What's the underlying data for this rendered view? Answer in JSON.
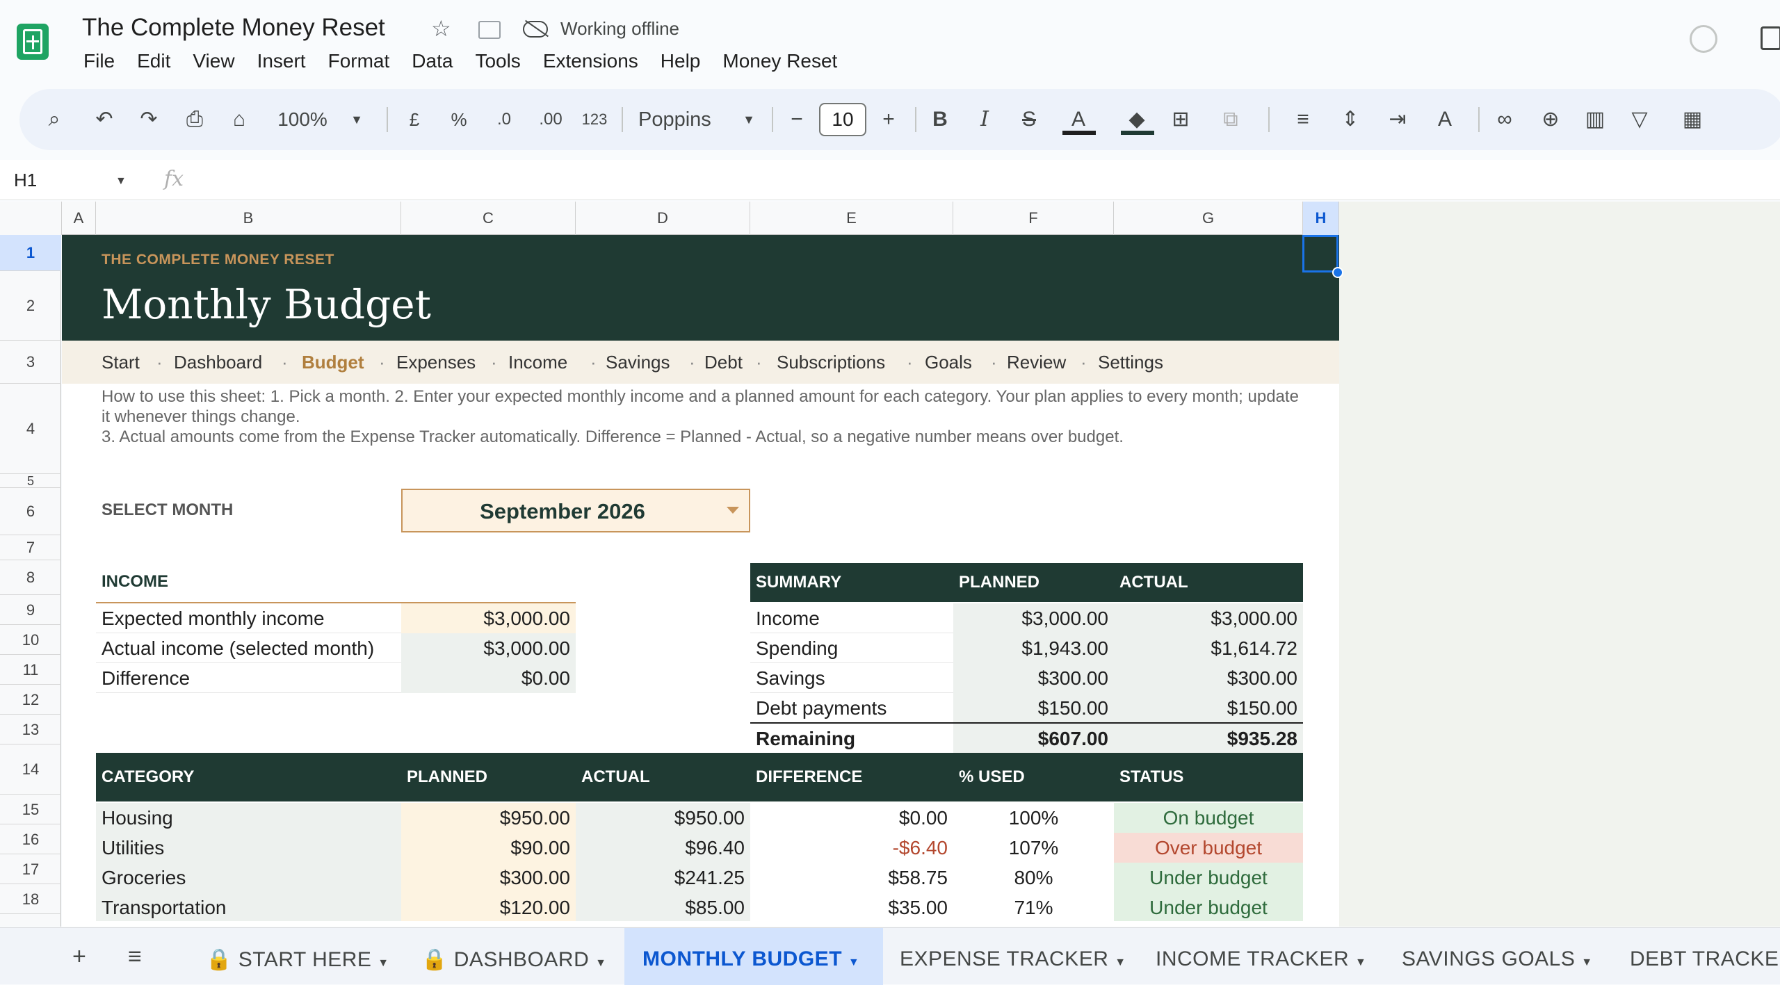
{
  "app": {
    "doc_title": "The Complete Money Reset",
    "status": "Working offline",
    "menu": [
      "File",
      "Edit",
      "View",
      "Insert",
      "Format",
      "Data",
      "Tools",
      "Extensions",
      "Help",
      "Money Reset"
    ]
  },
  "toolbar": {
    "zoom": "100%",
    "currency": "£",
    "percent": "%",
    "dec_decrease": ".0",
    "dec_increase": ".00",
    "format_123": "123",
    "font": "Poppins",
    "font_size": "10",
    "minus": "−",
    "plus": "+",
    "bold": "B",
    "italic": "I",
    "text_color": "A"
  },
  "formula_bar": {
    "name_box": "H1",
    "fx": "fx"
  },
  "columns": [
    "A",
    "B",
    "C",
    "D",
    "E",
    "F",
    "G",
    "H"
  ],
  "rows": [
    "1",
    "2",
    "3",
    "4",
    "5",
    "6",
    "7",
    "8",
    "9",
    "10",
    "11",
    "12",
    "13",
    "14",
    "15",
    "16",
    "17",
    "18"
  ],
  "sheet": {
    "kicker": "THE COMPLETE MONEY RESET",
    "title": "Monthly Budget",
    "nav": [
      "Start",
      "Dashboard",
      "Budget",
      "Expenses",
      "Income",
      "Savings",
      "Debt",
      "Subscriptions",
      "Goals",
      "Review",
      "Settings"
    ],
    "nav_sep": "·",
    "help": "How to use this sheet:  1. Pick a month.  2. Enter your expected monthly income and a planned amount for each category. Your plan applies to every month; update it whenever things change.\n3. Actual amounts come from the Expense Tracker automatically. Difference = Planned - Actual, so a negative number means over budget.",
    "select_month_label": "SELECT MONTH",
    "selected_month": "September 2026",
    "income": {
      "header": "INCOME",
      "rows": [
        {
          "label": "Expected monthly income",
          "value": "$3,000.00"
        },
        {
          "label": "Actual income (selected month)",
          "value": "$3,000.00"
        },
        {
          "label": "Difference",
          "value": "$0.00"
        }
      ]
    },
    "summary": {
      "headers": [
        "SUMMARY",
        "PLANNED",
        "ACTUAL"
      ],
      "rows": [
        {
          "label": "Income",
          "planned": "$3,000.00",
          "actual": "$3,000.00"
        },
        {
          "label": "Spending",
          "planned": "$1,943.00",
          "actual": "$1,614.72"
        },
        {
          "label": "Savings",
          "planned": "$300.00",
          "actual": "$300.00"
        },
        {
          "label": "Debt payments",
          "planned": "$150.00",
          "actual": "$150.00"
        },
        {
          "label": "Remaining",
          "planned": "$607.00",
          "actual": "$935.28"
        }
      ]
    },
    "categories": {
      "headers": [
        "CATEGORY",
        "PLANNED",
        "ACTUAL",
        "DIFFERENCE",
        "% USED",
        "STATUS"
      ],
      "rows": [
        {
          "category": "Housing",
          "planned": "$950.00",
          "actual": "$950.00",
          "difference": "$0.00",
          "used": "100%",
          "status": "On budget"
        },
        {
          "category": "Utilities",
          "planned": "$90.00",
          "actual": "$96.40",
          "difference": "-$6.40",
          "used": "107%",
          "status": "Over budget"
        },
        {
          "category": "Groceries",
          "planned": "$300.00",
          "actual": "$241.25",
          "difference": "$58.75",
          "used": "80%",
          "status": "Under budget"
        },
        {
          "category": "Transportation",
          "planned": "$120.00",
          "actual": "$85.00",
          "difference": "$35.00",
          "used": "71%",
          "status": "Under budget"
        }
      ]
    }
  },
  "sheet_tabs": [
    "START HERE",
    "DASHBOARD",
    "MONTHLY BUDGET",
    "EXPENSE TRACKER",
    "INCOME TRACKER",
    "SAVINGS GOALS",
    "DEBT TRACKER"
  ],
  "sheet_tab_controls": {
    "add": "+",
    "all": "≡"
  },
  "colors": {
    "header_green": "#1f3a33",
    "accent_gold": "#c8955b",
    "active_tab": "#0b57d0"
  }
}
